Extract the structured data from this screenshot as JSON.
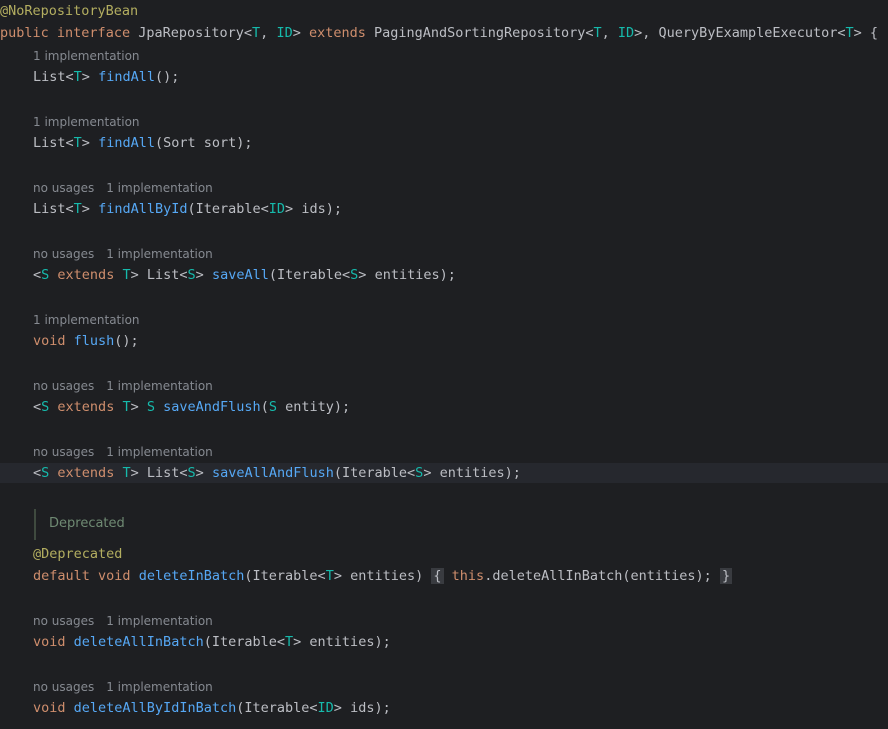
{
  "hints": {
    "one_impl": "1 implementation",
    "no_usages": "no usages"
  },
  "doc": {
    "deprecated_label": "Deprecated"
  },
  "code": {
    "anno_no_repo": "@NoRepositoryBean",
    "kw_public": "public",
    "kw_interface": "interface",
    "kw_extends": "extends",
    "kw_void": "void",
    "kw_default": "default",
    "kw_this": "this",
    "anno_deprecated": "@Deprecated",
    "interface_name": "JpaRepository",
    "super_paging": "PagingAndSortingRepository",
    "super_qbe": "QueryByExampleExecutor",
    "type_T": "T",
    "type_ID": "ID",
    "type_S": "S",
    "type_list": "List",
    "type_iterable": "Iterable",
    "type_sort": "Sort",
    "m_findAll": "findAll",
    "m_findAllById": "findAllById",
    "m_saveAll": "saveAll",
    "m_flush": "flush",
    "m_saveAndFlush": "saveAndFlush",
    "m_saveAllAndFlush": "saveAllAndFlush",
    "m_deleteInBatch": "deleteInBatch",
    "m_deleteAllInBatch": "deleteAllInBatch",
    "m_deleteAllByIdInBatch": "deleteAllByIdInBatch",
    "p_sort": "sort",
    "p_ids": "ids",
    "p_entities": "entities",
    "p_entity": "entity"
  }
}
